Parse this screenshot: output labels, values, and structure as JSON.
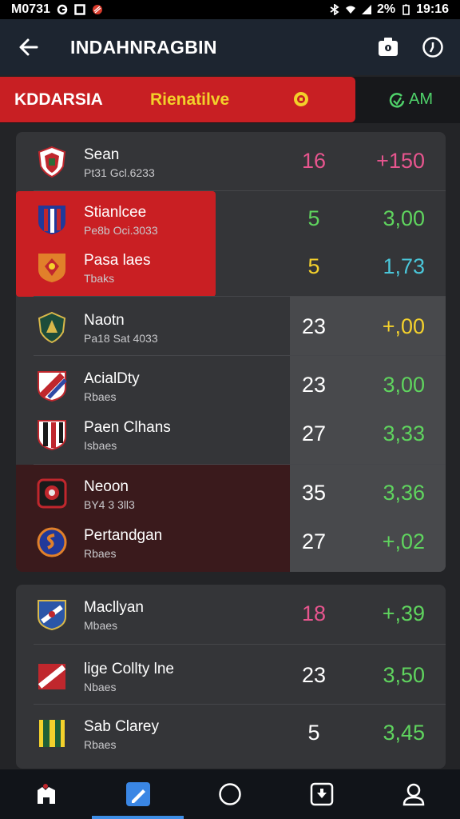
{
  "status": {
    "left_text": "M0731",
    "battery": "2%",
    "time": "19:16"
  },
  "appbar": {
    "title": "INDAHNRAGBIN"
  },
  "banner": {
    "label_left": "KDDARSIA",
    "label_mid": "Rienatilve",
    "side_label": "AM"
  },
  "colors": {
    "accent_red": "#c81f23",
    "pink": "#e7558e",
    "green": "#5fd45e",
    "yellow": "#f4d12c",
    "cyan": "#4ac6d9"
  },
  "card1": {
    "rows": [
      {
        "name": "Sean",
        "sub": "Pt31 Gcl.6233",
        "v1": "16",
        "v2": "+150",
        "v1c": "#e7558e",
        "v2c": "#e7558e"
      },
      {
        "name": "Stianlcee",
        "sub": "Pe8b Oci.3033",
        "v1": "5",
        "v2": "3,00",
        "v1c": "#5fd45e",
        "v2c": "#5fd45e"
      },
      {
        "name": "Pasa laes",
        "sub": "Tbaks",
        "v1": "5",
        "v2": "1,73",
        "v1c": "#f4d12c",
        "v2c": "#4ac6d9"
      },
      {
        "name": "Naotn",
        "sub": "Pa18 Sat 4033",
        "v1": "23",
        "v2": "+,00",
        "v1c": "#ffffff",
        "v2c": "#f4d12c"
      },
      {
        "name": "AcialDty",
        "sub": "Rbaes",
        "v1": "23",
        "v2": "3,00",
        "v1c": "#ffffff",
        "v2c": "#5fd45e"
      },
      {
        "name": "Paen Clhans",
        "sub": "Isbaes",
        "v1": "27",
        "v2": "3,33",
        "v1c": "#ffffff",
        "v2c": "#5fd45e"
      },
      {
        "name": "Neoon",
        "sub": "BY4 3 3ll3",
        "v1": "35",
        "v2": "3,36",
        "v1c": "#ffffff",
        "v2c": "#5fd45e"
      },
      {
        "name": "Pertandgan",
        "sub": "Rbaes",
        "v1": "27",
        "v2": "+,02",
        "v1c": "#ffffff",
        "v2c": "#5fd45e"
      }
    ]
  },
  "card2": {
    "rows": [
      {
        "name": "Macllyan",
        "sub": "Mbaes",
        "v1": "18",
        "v2": "+,39",
        "v1c": "#e7558e",
        "v2c": "#5fd45e"
      },
      {
        "name": "lige Collty lne",
        "sub": "Nbaes",
        "v1": "23",
        "v2": "3,50",
        "v1c": "#ffffff",
        "v2c": "#5fd45e"
      },
      {
        "name": "Sab Clarey",
        "sub": "Rbaes",
        "v1": "5",
        "v2": "3,45",
        "v1c": "#ffffff",
        "v2c": "#5fd45e"
      }
    ]
  },
  "icons": {
    "back": "arrow-left-icon",
    "camera": "camera-icon",
    "timer": "timer-icon",
    "nav": [
      "home-icon",
      "edit-icon",
      "circle-icon",
      "download-icon",
      "profile-icon"
    ]
  }
}
